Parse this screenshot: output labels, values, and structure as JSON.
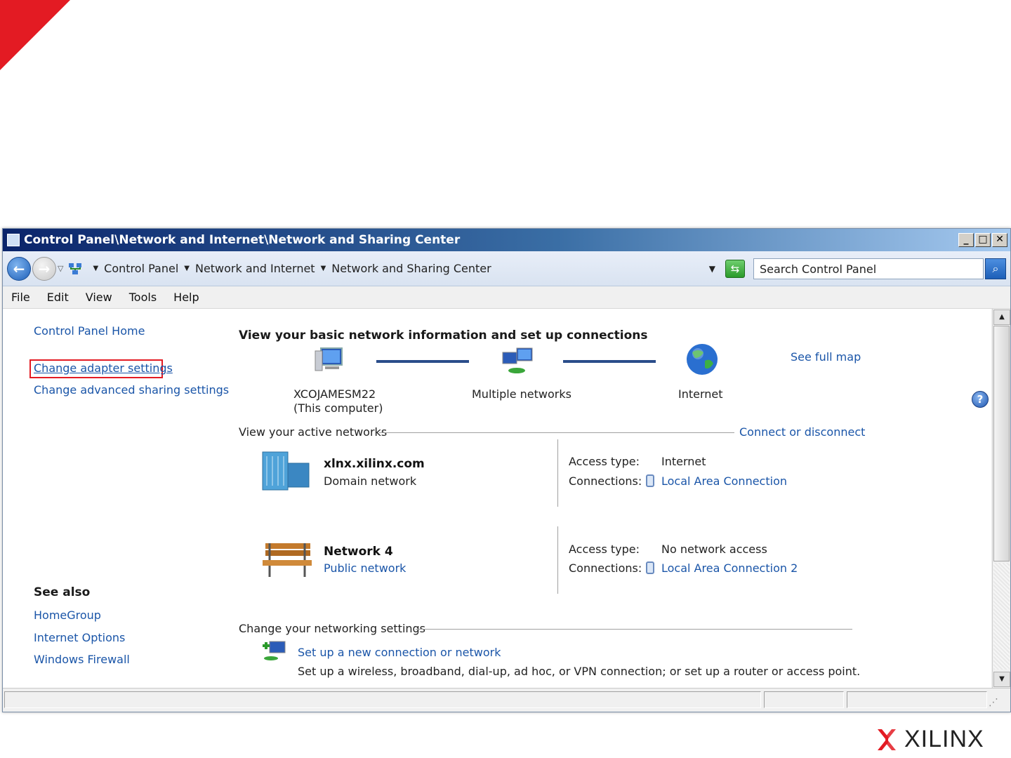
{
  "window": {
    "title": "Control Panel\\Network and Internet\\Network and Sharing Center",
    "controls": {
      "minimize": "_",
      "maximize": "□",
      "close": "✕"
    }
  },
  "address": {
    "crumbs": [
      "Control Panel",
      "Network and Internet",
      "Network and Sharing Center"
    ],
    "search_placeholder": "Search Control Panel"
  },
  "menu": [
    "File",
    "Edit",
    "View",
    "Tools",
    "Help"
  ],
  "sidebar": {
    "home": "Control Panel Home",
    "change_adapter": "Change adapter settings",
    "change_sharing": "Change advanced sharing settings",
    "see_also_title": "See also",
    "see_also": [
      "HomeGroup",
      "Internet Options",
      "Windows Firewall"
    ]
  },
  "main": {
    "heading": "View your basic network information and set up connections",
    "map": {
      "computer_name": "XCOJAMESM22",
      "computer_sub": "(This computer)",
      "multiple": "Multiple networks",
      "internet": "Internet",
      "see_full_map": "See full map"
    },
    "active_title": "View your active networks",
    "connect_link": "Connect or disconnect",
    "networks": [
      {
        "name": "xlnx.xilinx.com",
        "category": "Domain network",
        "access_label": "Access type:",
        "access_value": "Internet",
        "conn_label": "Connections:",
        "conn_value": "Local Area Connection"
      },
      {
        "name": "Network  4",
        "category": "Public network",
        "access_label": "Access type:",
        "access_value": "No network access",
        "conn_label": "Connections:",
        "conn_value": "Local Area Connection 2"
      }
    ],
    "settings_title": "Change your networking settings",
    "setup_link": "Set up a new connection or network",
    "setup_desc": "Set up a wireless, broadband, dial-up, ad hoc, or VPN connection; or set up a router or access point."
  },
  "branding": {
    "logo_text": "XILINX",
    "accent_color": "#e31b23"
  }
}
